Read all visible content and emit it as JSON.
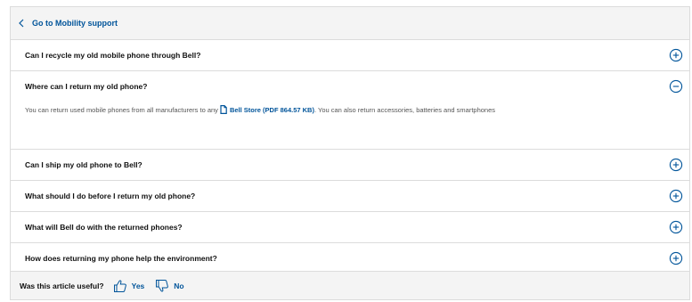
{
  "back": {
    "label": "Go to Mobility support"
  },
  "faq": {
    "items": [
      {
        "question": "Can I recycle my old mobile phone through Bell?",
        "expanded": false
      },
      {
        "question": "Where can I return my old phone?",
        "expanded": true
      },
      {
        "question": "Can I ship my old phone to Bell?",
        "expanded": false
      },
      {
        "question": "What should I do before I return my old phone?",
        "expanded": false
      },
      {
        "question": "What will Bell do with the returned phones?",
        "expanded": false
      },
      {
        "question": "How does returning my phone help the environment?",
        "expanded": false
      }
    ],
    "answer": {
      "text_before": "You can return used mobile phones from all manufacturers to any",
      "link_label": "Bell Store (PDF 864.57 KB)",
      "text_after": ". You can also return accessories, batteries and smartphones"
    }
  },
  "feedback": {
    "question": "Was this article useful?",
    "yes_label": "Yes",
    "no_label": "No"
  },
  "colors": {
    "accent": "#00549a",
    "panel_bg": "#f4f4f4",
    "border": "#dcdcdc"
  }
}
